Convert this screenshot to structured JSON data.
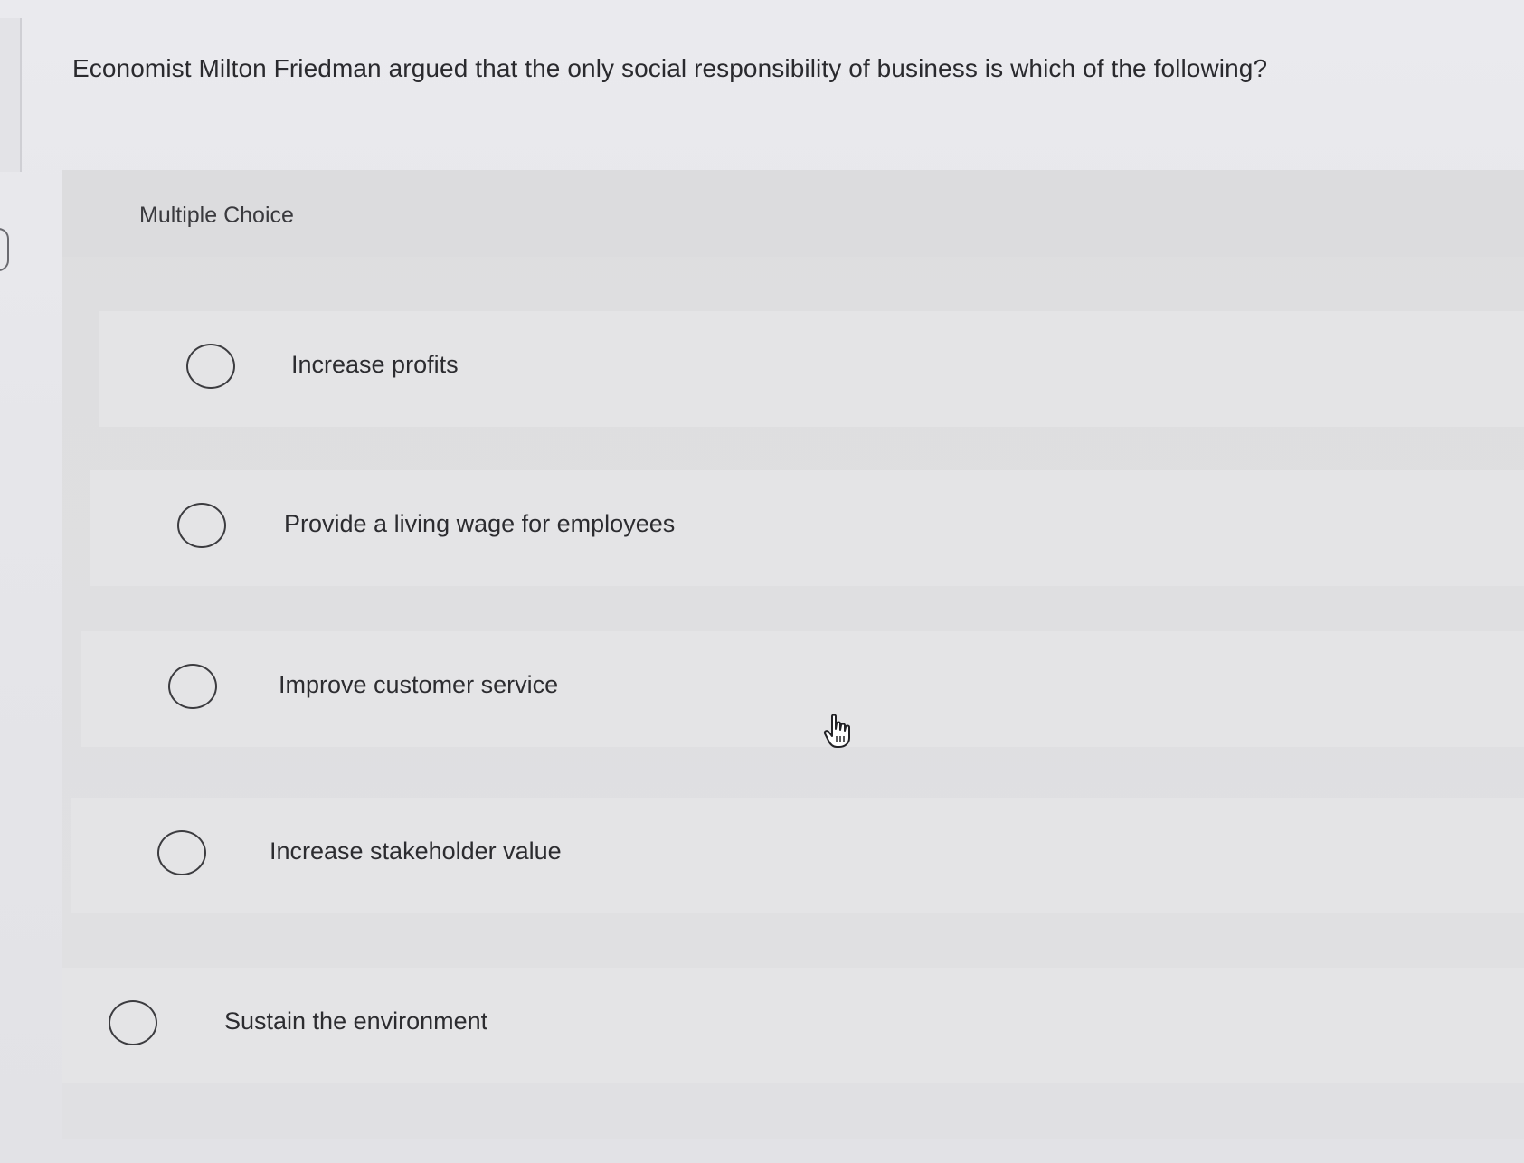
{
  "question": {
    "text": "Economist Milton Friedman argued that the only social responsibility of business is which of the following?"
  },
  "panel": {
    "type_label": "Multiple Choice"
  },
  "options": [
    {
      "label": "Increase profits",
      "selected": false
    },
    {
      "label": "Provide a living wage for employees",
      "selected": false
    },
    {
      "label": "Improve customer service",
      "selected": false
    },
    {
      "label": "Increase stakeholder value",
      "selected": false
    },
    {
      "label": "Sustain the environment",
      "selected": false
    }
  ],
  "icons": {
    "radio": "radio-button-empty-icon",
    "cursor": "hand-pointer-icon"
  }
}
